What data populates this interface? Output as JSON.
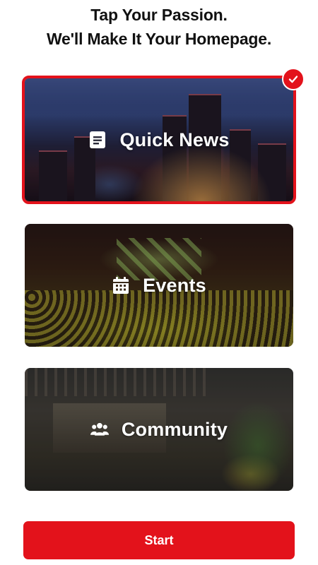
{
  "header": {
    "line1": "Tap Your Passion.",
    "line2": "We'll Make It Your Homepage."
  },
  "categories": [
    {
      "label": "Quick News",
      "icon": "news-icon",
      "selected": true
    },
    {
      "label": "Events",
      "icon": "calendar-icon",
      "selected": false
    },
    {
      "label": "Community",
      "icon": "people-icon",
      "selected": false
    }
  ],
  "start_button": {
    "label": "Start"
  },
  "colors": {
    "accent": "#e3121b",
    "text": "#111111",
    "card_text": "#ffffff"
  }
}
